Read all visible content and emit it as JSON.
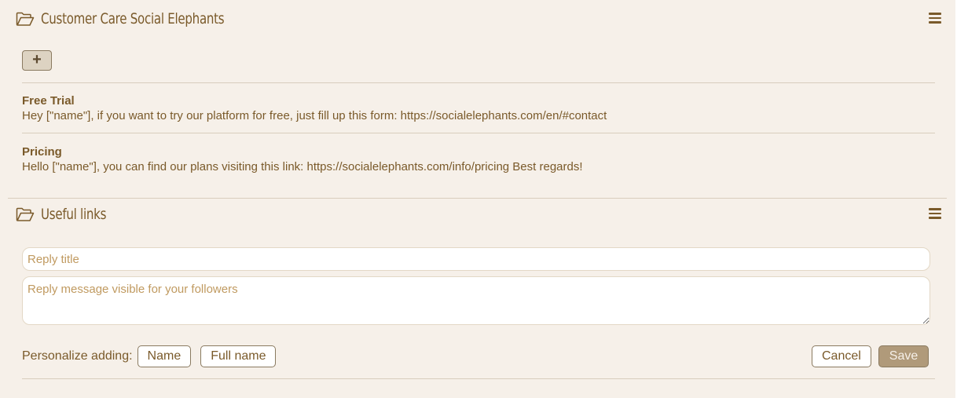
{
  "sections": [
    {
      "title": "Customer Care Social Elephants",
      "icon": "folder-open-icon",
      "add_label": "+",
      "replies": [
        {
          "title": "Free Trial",
          "text": "Hey [\"name\"], if you want to try our platform for free, just fill up this form: https://socialelephants.com/en/#contact"
        },
        {
          "title": "Pricing",
          "text": "Hello [\"name\"], you can find our plans visiting this link: https://socialelephants.com/info/pricing Best regards!"
        }
      ]
    },
    {
      "title": "Useful links",
      "icon": "folder-open-icon"
    }
  ],
  "form": {
    "title_placeholder": "Reply title",
    "message_placeholder": "Reply message visible for your followers",
    "personalize_label": "Personalize adding:",
    "personalize_buttons": [
      "Name",
      "Full name"
    ],
    "cancel_label": "Cancel",
    "save_label": "Save"
  },
  "colors": {
    "background": "#f6f0e9",
    "text": "#7a5a2a",
    "divider": "#d8cdbd",
    "save_button": "#b09a7a"
  }
}
